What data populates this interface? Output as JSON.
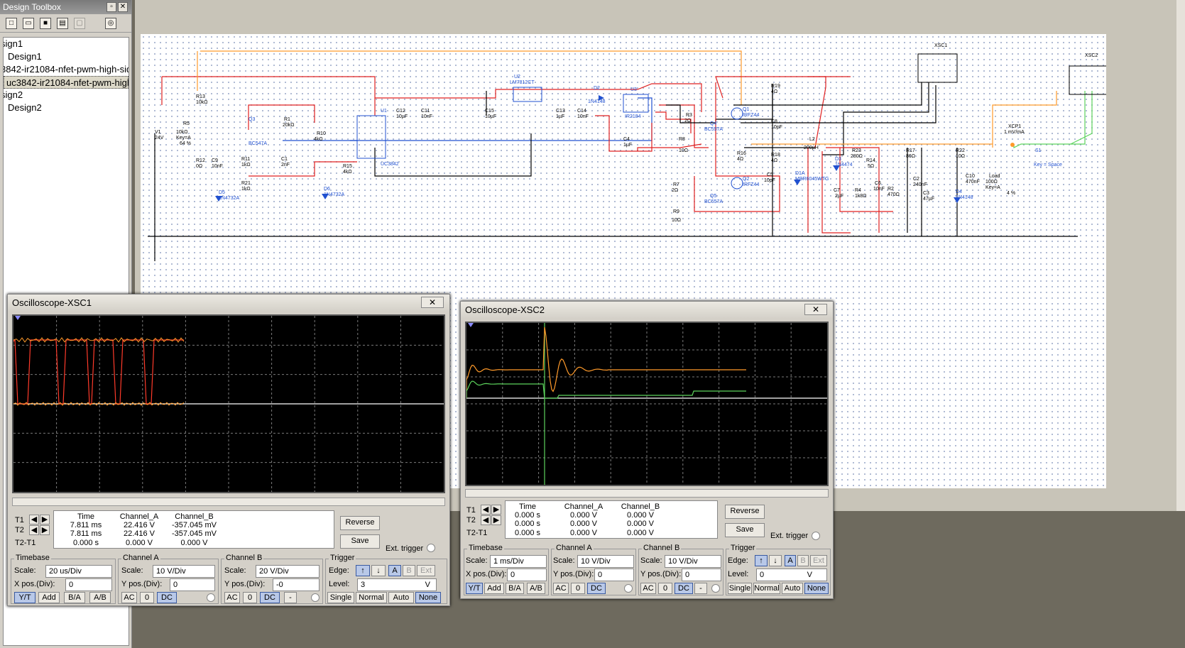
{
  "toolbox": {
    "title": "Design Toolbox",
    "tree": [
      "sign1",
      "Design1",
      "3842-ir21084-nfet-pwm-high-side",
      "uc3842-ir21084-nfet-pwm-high-s",
      "sign2",
      "Design2"
    ],
    "selected_index": 3
  },
  "schematic": {
    "labels": [
      "V1",
      "24V",
      "R5",
      "10kΩ",
      "Key=A",
      "64 %",
      "R13",
      "10kΩ",
      "R12",
      "0Ω",
      "C9",
      "10nF",
      "D5",
      "1N4732A",
      "Q3",
      "BC547A",
      "R11",
      "1kΩ",
      "R21",
      "1kΩ",
      "R1",
      "20kΩ",
      "R10",
      "4kΩ",
      "C1",
      "2nF",
      "D6",
      "1N4732A",
      "R15",
      "4kΩ",
      "U1",
      "UC3842",
      "C12",
      "10µF",
      "C11",
      "10nF",
      "U2",
      "LM7812CT",
      "C15",
      "10µF",
      "C13",
      "1µF",
      "C14",
      "10nF",
      "D2",
      "1N4148",
      "U3",
      "IR2184",
      "C4",
      "1µF",
      "R3",
      "2Ω",
      "R8",
      "10Ω",
      "Q4",
      "BC557A",
      "Q1",
      "IRFZ44",
      "R19",
      "4Ω",
      "C8",
      "10pF",
      "R16",
      "4Ω",
      "R18",
      "4Ω",
      "C5",
      "10pF",
      "R7",
      "2Ω",
      "Q2",
      "IRFZ44",
      "Q5",
      "BC557A",
      "R9",
      "10Ω",
      "D1A",
      "MBR6045WTG",
      "L2",
      "200µH",
      "D3",
      "1N4474",
      "C7",
      "2µF",
      "R23",
      "280Ω",
      "R14",
      "5Ω",
      "R4",
      "1k8Ω",
      "C6",
      "10nF",
      "R17",
      "86Ω",
      "R2",
      "470Ω",
      "C2",
      "240nF",
      "C3",
      "47µF",
      "R22",
      "10Ω",
      "D4",
      "1N4148",
      "C10",
      "470nF",
      "XSC1",
      "XSC2",
      "XCP1",
      "1 mV/mA",
      "S1",
      "Key = Space",
      "Load",
      "100Ω",
      "Key=A",
      "4 %"
    ]
  },
  "colors": {
    "trace_orange": "#ff9a2a",
    "trace_green": "#5cd35c",
    "trace_red": "#ff3a2a",
    "screen_bg": "#000000",
    "wire_red": "#e02020",
    "wire_blue": "#2050d0",
    "wire_black": "#000000"
  },
  "xsc1": {
    "title": "Oscilloscope-XSC1",
    "close": "✕",
    "readout_headers": [
      "Time",
      "Channel_A",
      "Channel_B"
    ],
    "row_labels": [
      "T1",
      "T2",
      "T2-T1"
    ],
    "rows": [
      [
        "7.811 ms",
        "22.416 V",
        "-357.045 mV"
      ],
      [
        "7.811 ms",
        "22.416 V",
        "-357.045 mV"
      ],
      [
        "0.000 s",
        "0.000 V",
        "0.000 V"
      ]
    ],
    "reverse": "Reverse",
    "save": "Save",
    "ext_trigger": "Ext. trigger",
    "timebase": {
      "title": "Timebase",
      "scale_label": "Scale:",
      "scale": "20 us/Div",
      "xpos_label": "X pos.(Div):",
      "xpos": "0",
      "buttons": [
        "Y/T",
        "Add",
        "B/A",
        "A/B"
      ]
    },
    "channel_a": {
      "title": "Channel A",
      "scale_label": "Scale:",
      "scale": "10  V/Div",
      "ypos_label": "Y pos.(Div):",
      "ypos": "0",
      "buttons": [
        "AC",
        "0",
        "DC"
      ]
    },
    "channel_b": {
      "title": "Channel B",
      "scale_label": "Scale:",
      "scale": "20  V/Div",
      "ypos_label": "Y pos.(Div):",
      "ypos": "-0",
      "buttons": [
        "AC",
        "0",
        "DC",
        "-"
      ]
    },
    "trigger": {
      "title": "Trigger",
      "edge_label": "Edge:",
      "level_label": "Level:",
      "level": "3",
      "unit": "V",
      "edge_buttons": [
        "↑",
        "↓",
        "A",
        "B",
        "Ext"
      ],
      "mode_buttons": [
        "Single",
        "Normal",
        "Auto",
        "None"
      ]
    }
  },
  "xsc2": {
    "title": "Oscilloscope-XSC2",
    "close": "✕",
    "readout_headers": [
      "Time",
      "Channel_A",
      "Channel_B"
    ],
    "row_labels": [
      "T1",
      "T2",
      "T2-T1"
    ],
    "rows": [
      [
        "0.000 s",
        "0.000 V",
        "0.000 V"
      ],
      [
        "0.000 s",
        "0.000 V",
        "0.000 V"
      ],
      [
        "0.000 s",
        "0.000 V",
        "0.000 V"
      ]
    ],
    "reverse": "Reverse",
    "save": "Save",
    "ext_trigger": "Ext. trigger",
    "timebase": {
      "title": "Timebase",
      "scale_label": "Scale:",
      "scale": "1 ms/Div",
      "xpos_label": "X pos.(Div):",
      "xpos": "0",
      "buttons": [
        "Y/T",
        "Add",
        "B/A",
        "A/B"
      ]
    },
    "channel_a": {
      "title": "Channel A",
      "scale_label": "Scale:",
      "scale": "10  V/Div",
      "ypos_label": "Y pos.(Div):",
      "ypos": "0",
      "buttons": [
        "AC",
        "0",
        "DC"
      ]
    },
    "channel_b": {
      "title": "Channel B",
      "scale_label": "Scale:",
      "scale": "10  V/Div",
      "ypos_label": "Y pos.(Div):",
      "ypos": "0",
      "buttons": [
        "AC",
        "0",
        "DC",
        "-"
      ]
    },
    "trigger": {
      "title": "Trigger",
      "edge_label": "Edge:",
      "level_label": "Level:",
      "level": "0",
      "unit": "V",
      "edge_buttons": [
        "↑",
        "↓",
        "A",
        "B",
        "Ext"
      ],
      "mode_buttons": [
        "Single",
        "Normal",
        "Auto",
        "None"
      ]
    }
  }
}
